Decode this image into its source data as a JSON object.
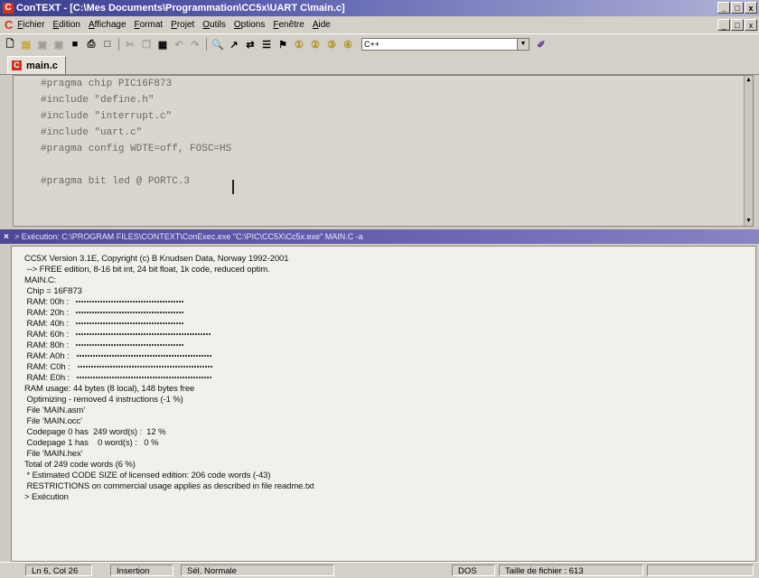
{
  "window": {
    "title": "ConTEXT - [C:\\Mes Documents\\Programmation\\CC5x\\UART C\\main.c]",
    "logo": "C",
    "controls": [
      "_",
      "□",
      "x"
    ]
  },
  "menu": {
    "logo": "C",
    "items": [
      "Fichier",
      "Edition",
      "Affichage",
      "Format",
      "Projet",
      "Outils",
      "Options",
      "Fenêtre",
      "Aide"
    ],
    "controls": [
      "_",
      "□",
      "x"
    ]
  },
  "toolbar": {
    "language": "C++"
  },
  "tabs": [
    {
      "label": "main.c",
      "icon": "c-file-icon"
    }
  ],
  "editor": {
    "lines": [
      "#pragma chip PIC16F873",
      "#include \"define.h\"",
      "#include \"interrupt.c\"",
      "#include \"uart.c\"",
      "#pragma config WDTE=off, FOSC=HS",
      "",
      "#pragma bit led @ PORTC.3"
    ]
  },
  "execution": {
    "header": "> Exécution: C:\\PROGRAM FILES\\CONTEXT\\ConExec.exe \"C:\\PIC\\CC5X\\Cc5x.exe\" MAIN.C -a",
    "lines": [
      "CC5X Version 3.1E, Copyright (c) B Knudsen Data, Norway 1992-2001",
      " --> FREE edition, 8-16 bit int, 24 bit float, 1k code, reduced optim.",
      "MAIN.C:",
      " Chip = 16F873",
      " RAM: 00h :",
      " RAM: 20h :",
      " RAM: 40h :",
      " RAM: 60h :",
      " RAM: 80h :",
      " RAM: A0h :",
      " RAM: C0h :",
      " RAM: E0h :",
      "RAM usage: 44 bytes (8 local), 148 bytes free",
      " Optimizing - removed 4 instructions (-1 %)",
      " File 'MAIN.asm'",
      " File 'MAIN.occ'",
      " Codepage 0 has  249 word(s) :  12 %",
      " Codepage 1 has    0 word(s) :   0 %",
      " File 'MAIN.hex'",
      "Total of 249 code words (6 %)",
      " * Estimated CODE SIZE of licensed edition: 206 code words (-43)",
      " RESTRICTIONS on commercial usage applies as described in file readme.txt",
      "> Exécution"
    ]
  },
  "status": {
    "position": "Ln 6, Col 26",
    "mode": "Insertion",
    "selection": "Sél. Normale",
    "format": "DOS",
    "filesize": "Taille de fichier : 613"
  }
}
